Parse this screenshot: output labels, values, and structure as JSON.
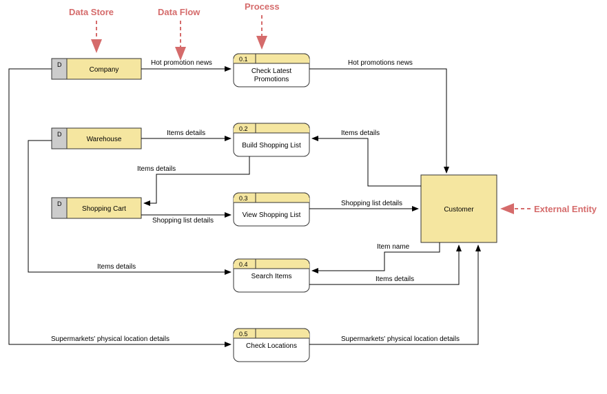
{
  "annotations": {
    "data_store": "Data Store",
    "data_flow": "Data Flow",
    "process": "Process",
    "external_entity": "External Entity"
  },
  "data_stores": {
    "company": {
      "tag": "D",
      "label": "Company"
    },
    "warehouse": {
      "tag": "D",
      "label": "Warehouse"
    },
    "shopping_cart": {
      "tag": "D",
      "label": "Shopping Cart"
    }
  },
  "processes": {
    "p01": {
      "num": "0.1",
      "label": "Check Latest Promotions"
    },
    "p02": {
      "num": "0.2",
      "label": "Build Shopping List"
    },
    "p03": {
      "num": "0.3",
      "label": "View Shopping List"
    },
    "p04": {
      "num": "0.4",
      "label": "Search Items"
    },
    "p05": {
      "num": "0.5",
      "label": "Check Locations"
    }
  },
  "entities": {
    "customer": {
      "label": "Customer"
    }
  },
  "flows": {
    "f1": "Hot promotion news",
    "f2": "Hot promotions news",
    "f3": "Items details",
    "f4": "Items details",
    "f5": "Items details",
    "f6": "Shopping list details",
    "f7": "Shopping list details",
    "f8": "Item name",
    "f9": "Items details",
    "f10": "Items details",
    "f11": "Supermarkets' physical location details",
    "f12": "Supermarkets' physical location details"
  },
  "chart_data": {
    "type": "diagram",
    "diagram_type": "data-flow-diagram",
    "title": "",
    "data_stores": [
      {
        "id": "D",
        "name": "Company"
      },
      {
        "id": "D",
        "name": "Warehouse"
      },
      {
        "id": "D",
        "name": "Shopping Cart"
      }
    ],
    "processes": [
      {
        "id": "0.1",
        "name": "Check Latest Promotions"
      },
      {
        "id": "0.2",
        "name": "Build Shopping List"
      },
      {
        "id": "0.3",
        "name": "View Shopping List"
      },
      {
        "id": "0.4",
        "name": "Search Items"
      },
      {
        "id": "0.5",
        "name": "Check Locations"
      }
    ],
    "external_entities": [
      {
        "name": "Customer"
      }
    ],
    "flows": [
      {
        "from": "Company",
        "to": "Check Latest Promotions",
        "label": "Hot promotion news"
      },
      {
        "from": "Check Latest Promotions",
        "to": "Customer",
        "label": "Hot promotions news"
      },
      {
        "from": "Warehouse",
        "to": "Build Shopping List",
        "label": "Items details"
      },
      {
        "from": "Customer",
        "to": "Build Shopping List",
        "label": "Items details"
      },
      {
        "from": "Build Shopping List",
        "to": "Shopping Cart",
        "label": "Items details"
      },
      {
        "from": "Shopping Cart",
        "to": "View Shopping List",
        "label": "Shopping list details"
      },
      {
        "from": "View Shopping List",
        "to": "Customer",
        "label": "Shopping list details"
      },
      {
        "from": "Customer",
        "to": "Search Items",
        "label": "Item name"
      },
      {
        "from": "Warehouse",
        "to": "Search Items",
        "label": "Items details"
      },
      {
        "from": "Search Items",
        "to": "Customer",
        "label": "Items details"
      },
      {
        "from": "Company",
        "to": "Check Locations",
        "label": "Supermarkets' physical location details"
      },
      {
        "from": "Check Locations",
        "to": "Customer",
        "label": "Supermarkets' physical location details"
      }
    ],
    "legend_annotations": [
      "Data Store",
      "Data Flow",
      "Process",
      "External Entity"
    ]
  }
}
